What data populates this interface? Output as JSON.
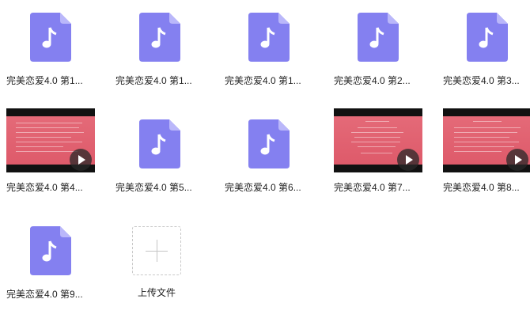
{
  "colors": {
    "audio_icon": "#8480f0",
    "audio_icon_fold": "#bab7fa",
    "video_frame": "#e05e6d"
  },
  "files": [
    {
      "name": "完美恋爱4.0 第1...",
      "type": "audio",
      "icon": "music-file-icon"
    },
    {
      "name": "完美恋爱4.0 第1...",
      "type": "audio",
      "icon": "music-file-icon"
    },
    {
      "name": "完美恋爱4.0 第1...",
      "type": "audio",
      "icon": "music-file-icon"
    },
    {
      "name": "完美恋爱4.0 第2...",
      "type": "audio",
      "icon": "music-file-icon"
    },
    {
      "name": "完美恋爱4.0 第3...",
      "type": "audio",
      "icon": "music-file-icon"
    },
    {
      "name": "完美恋爱4.0 第4...",
      "type": "video",
      "icon": "play-icon"
    },
    {
      "name": "完美恋爱4.0 第5...",
      "type": "audio",
      "icon": "music-file-icon"
    },
    {
      "name": "完美恋爱4.0 第6...",
      "type": "audio",
      "icon": "music-file-icon"
    },
    {
      "name": "完美恋爱4.0 第7...",
      "type": "video",
      "icon": "play-icon"
    },
    {
      "name": "完美恋爱4.0 第8...",
      "type": "video",
      "icon": "play-icon"
    },
    {
      "name": "完美恋爱4.0 第9...",
      "type": "audio",
      "icon": "music-file-icon"
    }
  ],
  "upload": {
    "label": "上传文件",
    "icon": "plus-icon"
  }
}
